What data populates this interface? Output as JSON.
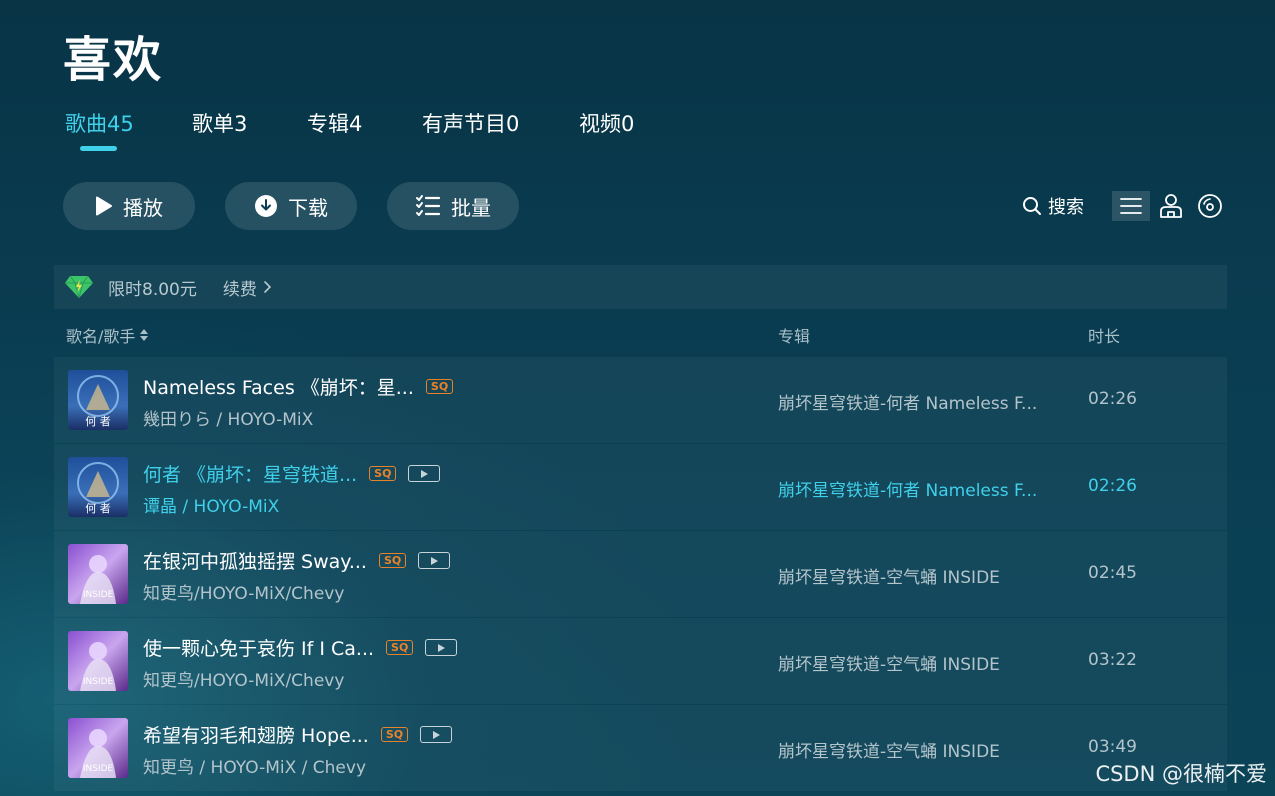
{
  "page": {
    "title": "喜欢"
  },
  "tabs": [
    {
      "label": "歌曲45",
      "active": true
    },
    {
      "label": "歌单3",
      "active": false
    },
    {
      "label": "专辑4",
      "active": false
    },
    {
      "label": "有声节目0",
      "active": false
    },
    {
      "label": "视频0",
      "active": false
    }
  ],
  "toolbar": {
    "play_label": "播放",
    "download_label": "下载",
    "batch_label": "批量",
    "search_label": "搜索"
  },
  "vip_bar": {
    "price_text": "限时8.00元",
    "renew_label": "续费"
  },
  "columns": {
    "song": "歌名/歌手",
    "album": "专辑",
    "duration": "时长"
  },
  "songs": [
    {
      "title": "Nameless Faces 《崩坏：星...",
      "artist": "幾田りら / HOYO-MiX",
      "album": "崩坏星穹铁道-何者 Nameless F...",
      "duration": "02:26",
      "sq": "SQ",
      "mv": false,
      "playing": false,
      "cover": "cover-heze"
    },
    {
      "title": "何者 《崩坏：星穹铁道...",
      "artist": "谭晶 / HOYO-MiX",
      "album": "崩坏星穹铁道-何者 Nameless F...",
      "duration": "02:26",
      "sq": "SQ",
      "mv": true,
      "playing": true,
      "cover": "cover-heze"
    },
    {
      "title": "在银河中孤独摇摆 Sway...",
      "artist": "知更鸟/HOYO-MiX/Chevy",
      "album": "崩坏星穹铁道-空气蛹 INSIDE",
      "duration": "02:45",
      "sq": "SQ",
      "mv": true,
      "playing": false,
      "cover": "cover-inside"
    },
    {
      "title": "使一颗心免于哀伤 If I Ca...",
      "artist": "知更鸟/HOYO-MiX/Chevy",
      "album": "崩坏星穹铁道-空气蛹 INSIDE",
      "duration": "03:22",
      "sq": "SQ",
      "mv": true,
      "playing": false,
      "cover": "cover-inside"
    },
    {
      "title": "希望有羽毛和翅膀 Hope...",
      "artist": "知更鸟 / HOYO-MiX / Chevy",
      "album": "崩坏星穹铁道-空气蛹 INSIDE",
      "duration": "03:49",
      "sq": "SQ",
      "mv": true,
      "playing": false,
      "cover": "cover-inside"
    }
  ],
  "covers": {
    "heze_text": "何 者",
    "inside_text": "INSIDE"
  },
  "watermark": "CSDN @很楠不爱",
  "colors": {
    "accent": "#3fd0ea",
    "sq_badge": "#e8822a",
    "background": "#083446"
  }
}
